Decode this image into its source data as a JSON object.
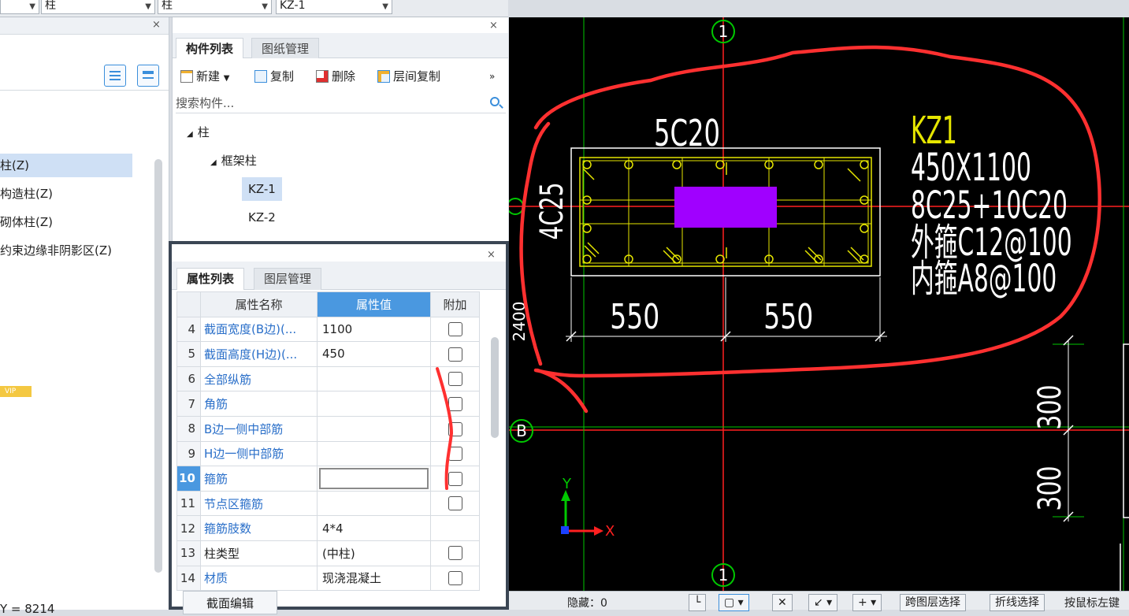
{
  "top_bar": {
    "combo1": "",
    "combo2": "柱",
    "combo3": "柱",
    "combo4": "KZ-1"
  },
  "left_panel": {
    "items": [
      "柱(Z)",
      "构造柱(Z)",
      "砌体柱(Z)",
      "约束边缘非阴影区(Z)"
    ],
    "vip": "VIP",
    "coord": "Y = 8214"
  },
  "component_panel": {
    "tabs": [
      "构件列表",
      "图纸管理"
    ],
    "toolbar": {
      "new": "新建",
      "copy": "复制",
      "delete": "删除",
      "floor_copy": "层间复制",
      "more": "»"
    },
    "search_placeholder": "搜索构件...",
    "tree": {
      "root": "柱",
      "group": "框架柱",
      "items": [
        "KZ-1",
        "KZ-2"
      ]
    }
  },
  "property_panel": {
    "tabs": [
      "属性列表",
      "图层管理"
    ],
    "headers": {
      "name": "属性名称",
      "value": "属性值",
      "extra": "附加"
    },
    "rows": [
      {
        "num": "4",
        "name": "截面宽度(B边)(...",
        "value": "1100",
        "check": true,
        "blue": true
      },
      {
        "num": "5",
        "name": "截面高度(H边)(...",
        "value": "450",
        "check": true,
        "blue": true
      },
      {
        "num": "6",
        "name": "全部纵筋",
        "value": "",
        "check": true,
        "blue": true
      },
      {
        "num": "7",
        "name": "角筋",
        "value": "",
        "check": true,
        "blue": true
      },
      {
        "num": "8",
        "name": "B边一侧中部筋",
        "value": "",
        "check": true,
        "blue": true
      },
      {
        "num": "9",
        "name": "H边一侧中部筋",
        "value": "",
        "check": true,
        "blue": true
      },
      {
        "num": "10",
        "name": "箍筋",
        "value": "",
        "check": true,
        "blue": true,
        "current": true
      },
      {
        "num": "11",
        "name": "节点区箍筋",
        "value": "",
        "check": true,
        "blue": true
      },
      {
        "num": "12",
        "name": "箍筋肢数",
        "value": "4*4",
        "check": false,
        "blue": true
      },
      {
        "num": "13",
        "name": "柱类型",
        "value": "(中柱)",
        "check": true,
        "blue": false
      },
      {
        "num": "14",
        "name": "材质",
        "value": "现浇混凝土",
        "check": true,
        "blue": true
      }
    ],
    "section_edit": "截面编辑"
  },
  "cad": {
    "axis_top": "1",
    "axis_bottom": "1",
    "axis_left": "B",
    "top_rebar": "5C20",
    "side_rebar": "4C25",
    "label_name": "KZ1",
    "label_size": "450X1100",
    "label_main": "8C25+10C20",
    "label_outer": "外箍C12@100",
    "label_inner": "内箍A8@100",
    "dim1": "550",
    "dim2": "550",
    "dim_left": "2400",
    "dim_r1": "300",
    "dim_r2": "300",
    "axis_x": "X",
    "axis_y": "Y",
    "colors": {
      "bg": "#000000",
      "grid": "#00c800",
      "axis_line": "#ff2020",
      "rebar": "#e6e600",
      "column_fill": "#a000ff",
      "annotation": "#ff3030",
      "text": "#ffffff"
    }
  },
  "status_bar": {
    "hidden": "隐藏：0",
    "btn1": "跨图层选择",
    "btn2": "折线选择",
    "btn3": "按鼠标左键"
  }
}
